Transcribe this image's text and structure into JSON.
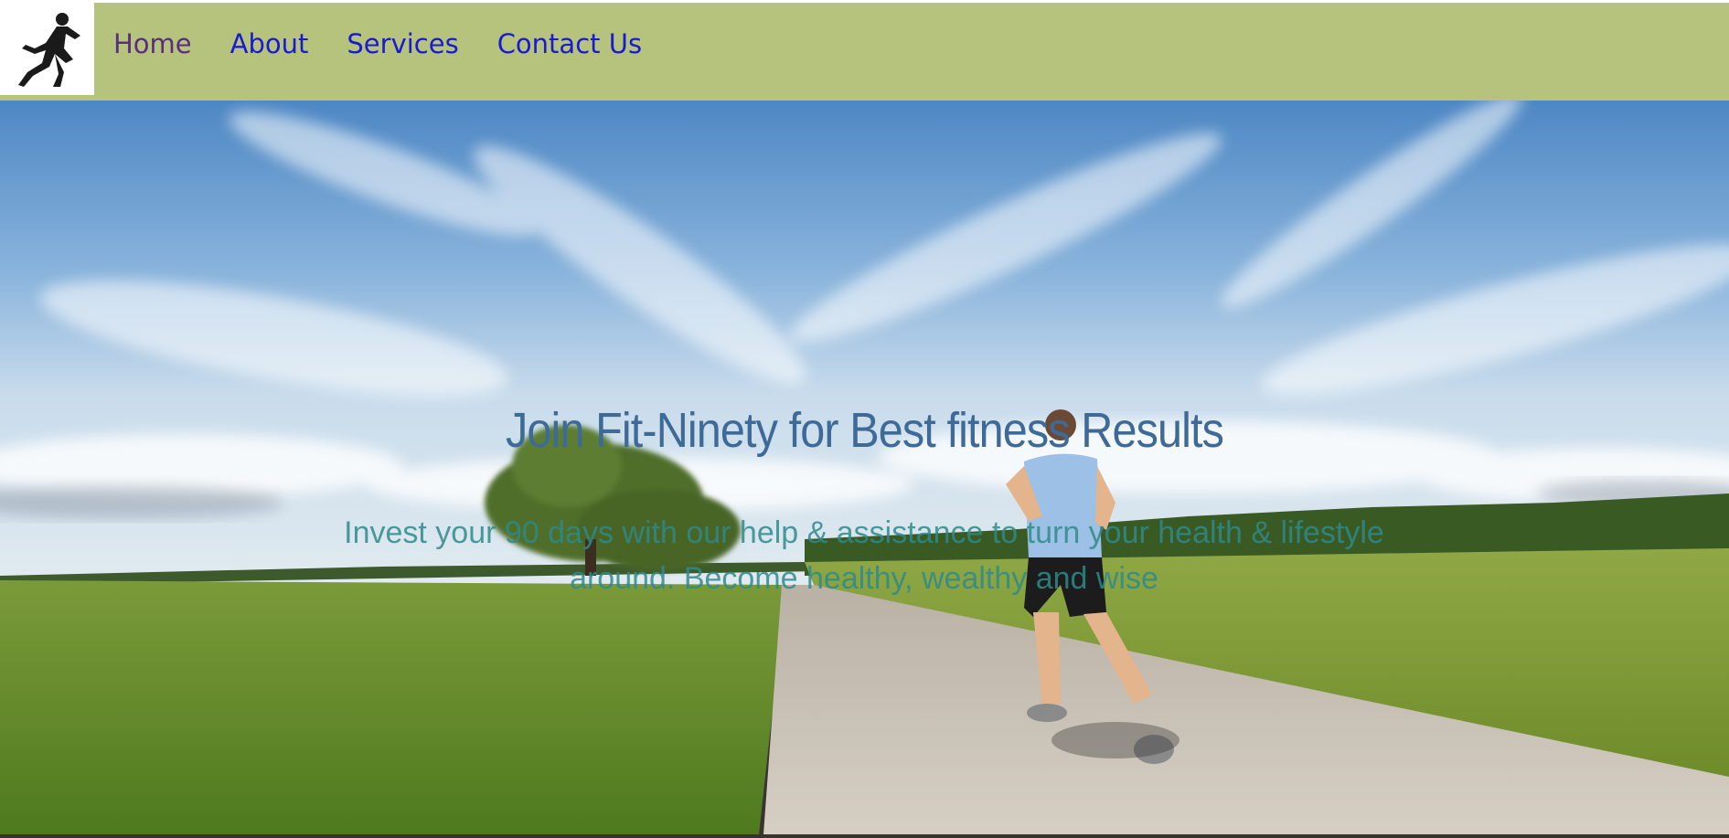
{
  "nav": {
    "logo_alt": "runner-logo",
    "items": [
      {
        "label": "Home"
      },
      {
        "label": "About"
      },
      {
        "label": "Services"
      },
      {
        "label": "Contact Us"
      }
    ]
  },
  "hero": {
    "title": "Join Fit-Ninety for Best fitness Results",
    "subtitle": "Invest your 90 days with our help & assistance to turn your health & lifestyle around. Become healthy, wealthy and wise"
  },
  "colors": {
    "navbar_bg": "#b5c37c",
    "link": "#1a1ad0",
    "link_visited": "#5a2e7a",
    "title": "#3e6a98",
    "subtitle": "#2f8a8a"
  }
}
